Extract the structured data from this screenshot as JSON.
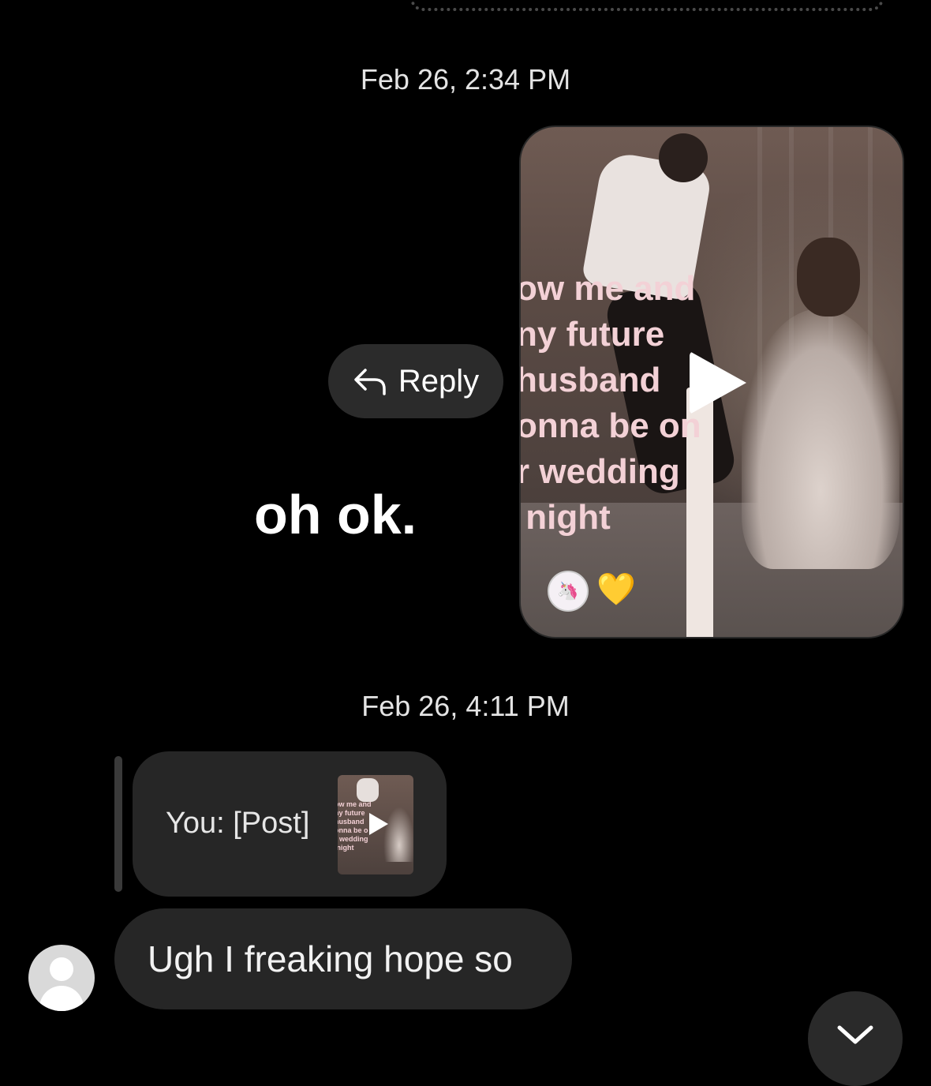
{
  "thread": {
    "timestamp_1": "Feb 26, 2:34 PM",
    "timestamp_2": "Feb 26, 4:11 PM"
  },
  "shared_post": {
    "overlay_text": "ow me and\nny future\nhusband\nonna be on\nr wedding\n night",
    "reaction_emoji": "💛",
    "sticker_icon": "unicorn-sticker-icon"
  },
  "reply_button": {
    "label": "Reply",
    "icon": "reply-arrow-icon"
  },
  "big_message": "oh ok.",
  "quoted_reply": {
    "label": "You: [Post]",
    "thumb_text": "ow me and\nny future\nhusband\nonna be o\nr wedding\n night"
  },
  "incoming_message": "Ugh I freaking hope so",
  "scroll_button": {
    "icon": "chevron-down-icon"
  },
  "colors": {
    "background": "#000000",
    "bubble": "#262626",
    "overlay_pink": "#f3d1d6",
    "heart": "#f5c445"
  }
}
